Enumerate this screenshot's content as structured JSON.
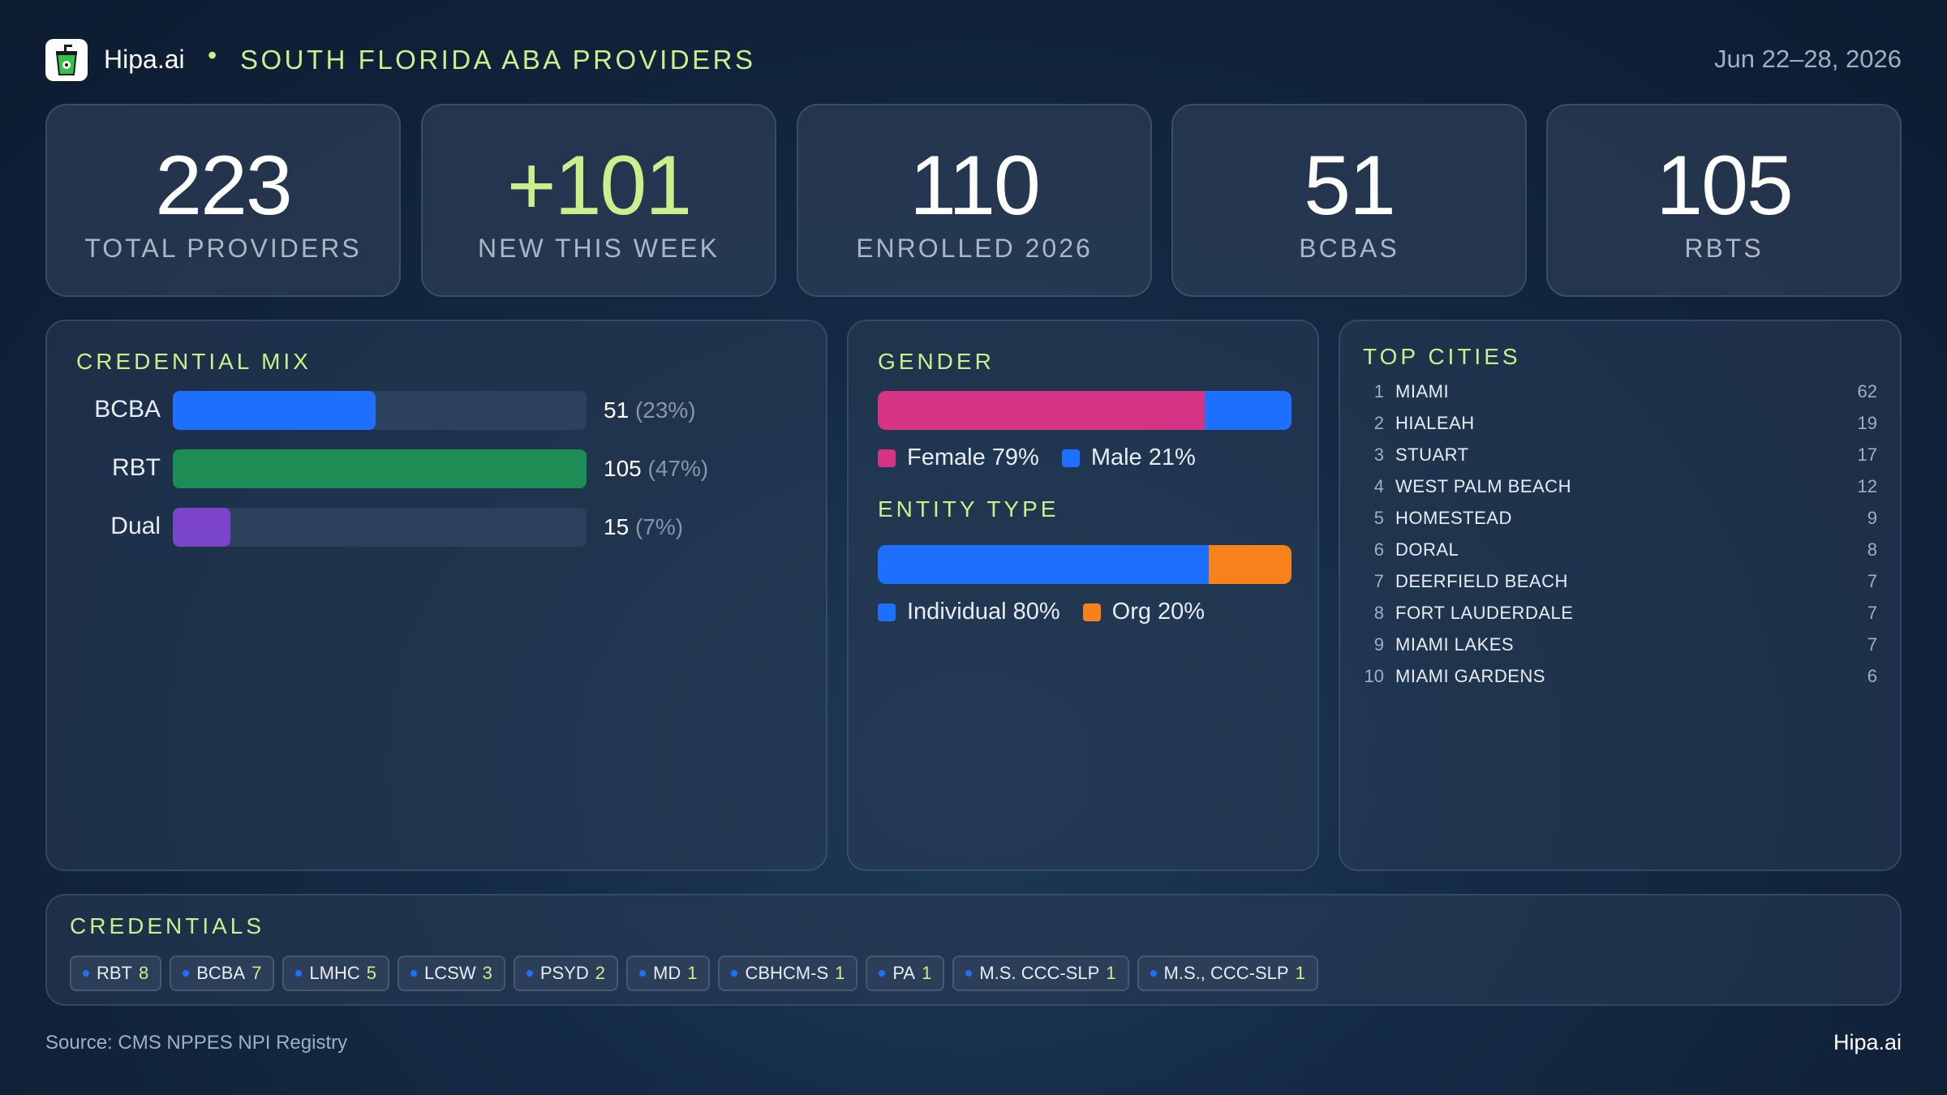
{
  "header": {
    "brand": "Hipa.ai",
    "separator": "•",
    "title": "SOUTH FLORIDA ABA PROVIDERS",
    "date_range": "Jun 22–28, 2026"
  },
  "stats": [
    {
      "value": "223",
      "label": "TOTAL PROVIDERS"
    },
    {
      "value": "+101",
      "label": "NEW THIS WEEK"
    },
    {
      "value": "110",
      "label": "ENROLLED 2026"
    },
    {
      "value": "51",
      "label": "BCBAS"
    },
    {
      "value": "105",
      "label": "RBTS"
    }
  ],
  "credential_mix": {
    "title": "CREDENTIAL MIX",
    "rows": [
      {
        "label": "BCBA",
        "count": "51",
        "pct": "(23%)",
        "fraction": 0.49,
        "color": "#1f6fff"
      },
      {
        "label": "RBT",
        "count": "105",
        "pct": "(47%)",
        "fraction": 1.0,
        "color": "#1e8c55"
      },
      {
        "label": "Dual",
        "count": "15",
        "pct": "(7%)",
        "fraction": 0.14,
        "color": "#7a45c8"
      }
    ]
  },
  "gender": {
    "title": "GENDER",
    "segments": [
      {
        "label": "Female 79%",
        "fraction": 0.79,
        "color": "#d63384"
      },
      {
        "label": "Male 21%",
        "fraction": 0.21,
        "color": "#1f6fff"
      }
    ]
  },
  "entity_type": {
    "title": "ENTITY TYPE",
    "segments": [
      {
        "label": "Individual 80%",
        "fraction": 0.8,
        "color": "#1f6fff"
      },
      {
        "label": "Org 20%",
        "fraction": 0.2,
        "color": "#f7821b"
      }
    ]
  },
  "top_cities": {
    "title": "TOP CITIES",
    "rows": [
      {
        "rank": "1",
        "name": "MIAMI",
        "count": "62"
      },
      {
        "rank": "2",
        "name": "HIALEAH",
        "count": "19"
      },
      {
        "rank": "3",
        "name": "STUART",
        "count": "17"
      },
      {
        "rank": "4",
        "name": "WEST PALM BEACH",
        "count": "12"
      },
      {
        "rank": "5",
        "name": "HOMESTEAD",
        "count": "9"
      },
      {
        "rank": "6",
        "name": "DORAL",
        "count": "8"
      },
      {
        "rank": "7",
        "name": "DEERFIELD BEACH",
        "count": "7"
      },
      {
        "rank": "8",
        "name": "FORT LAUDERDALE",
        "count": "7"
      },
      {
        "rank": "9",
        "name": "MIAMI LAKES",
        "count": "7"
      },
      {
        "rank": "10",
        "name": "MIAMI GARDENS",
        "count": "6"
      }
    ]
  },
  "credentials": {
    "title": "CREDENTIALS",
    "chips": [
      {
        "name": "RBT",
        "count": "8"
      },
      {
        "name": "BCBA",
        "count": "7"
      },
      {
        "name": "LMHC",
        "count": "5"
      },
      {
        "name": "LCSW",
        "count": "3"
      },
      {
        "name": "PSYD",
        "count": "2"
      },
      {
        "name": "MD",
        "count": "1"
      },
      {
        "name": "CBHCM-S",
        "count": "1"
      },
      {
        "name": "PA",
        "count": "1"
      },
      {
        "name": "M.S. CCC-SLP",
        "count": "1"
      },
      {
        "name": "M.S., CCC-SLP",
        "count": "1"
      }
    ]
  },
  "footer": {
    "source": "Source: CMS NPPES NPI Registry",
    "brand": "Hipa.ai"
  },
  "colors": {
    "accent": "#c9f08b",
    "blue": "#1f6fff",
    "green": "#1e8c55",
    "purple": "#7a45c8",
    "pink": "#d63384",
    "orange": "#f7821b"
  },
  "icons": {
    "logo": "drink-cup-icon"
  }
}
